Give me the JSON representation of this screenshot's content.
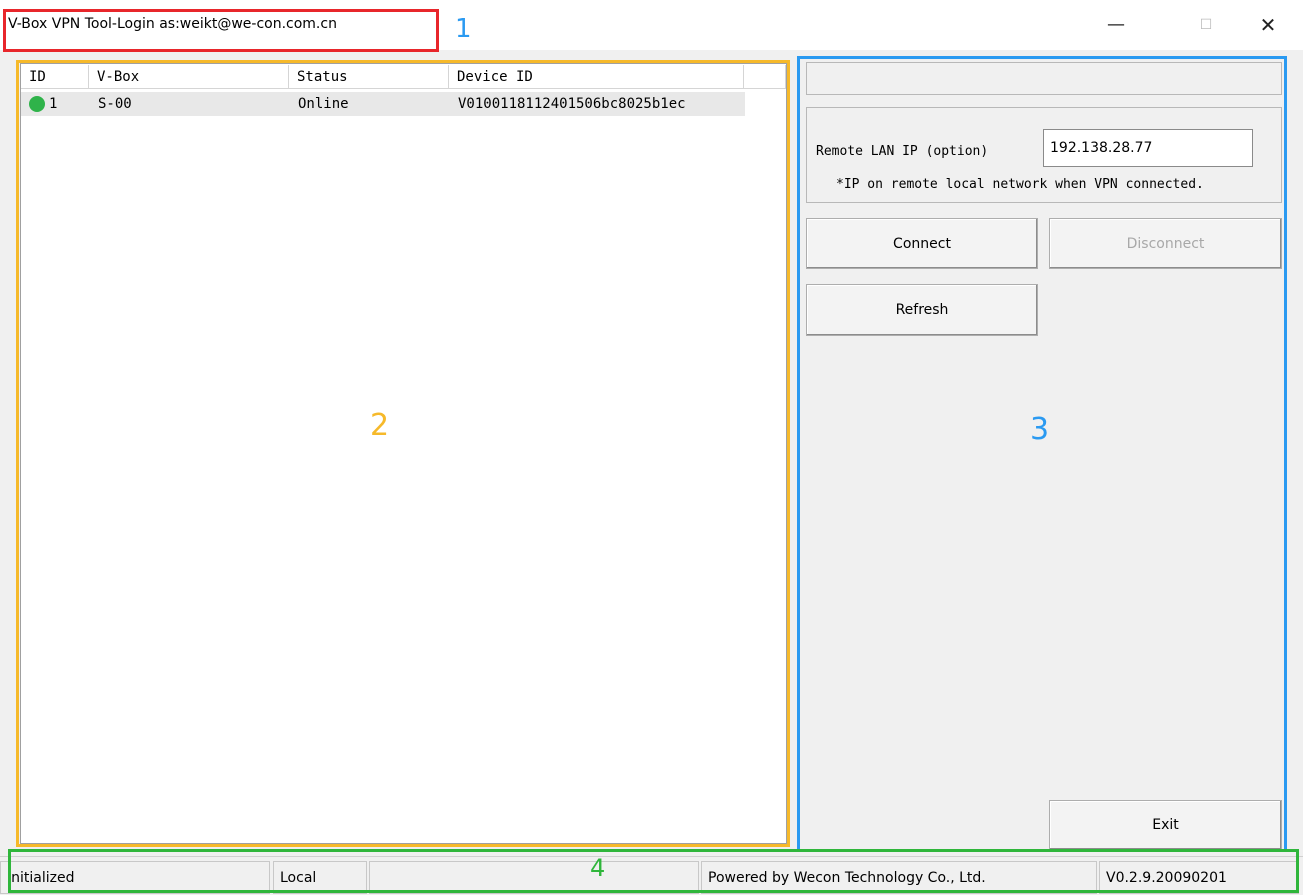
{
  "window": {
    "title": "V-Box VPN Tool-Login as:weikt@we-con.com.cn",
    "min_glyph": "—",
    "max_glyph": "☐",
    "close_glyph": "✕"
  },
  "annotations": [
    "1",
    "2",
    "3",
    "4"
  ],
  "device_list": {
    "columns": [
      "ID",
      "V-Box",
      "Status",
      "Device ID"
    ],
    "rows": [
      {
        "id": "1",
        "vbox": "S-00",
        "status": "Online",
        "device_id": "V0100118112401506bc8025b1ec",
        "status_color": "#2fb34a"
      }
    ]
  },
  "vpn_panel": {
    "remote_ip_label": "Remote LAN IP (option)",
    "remote_ip_value": "192.138.28.77",
    "remote_ip_note": "*IP on remote local network when VPN connected.",
    "connect_label": "Connect",
    "disconnect_label": "Disconnect",
    "refresh_label": "Refresh",
    "exit_label": "Exit"
  },
  "status_bar": {
    "state": "Initialized",
    "mode": "Local",
    "empty": "",
    "powered_by": "Powered by Wecon Technology Co., Ltd.",
    "version": "V0.2.9.20090201"
  },
  "colors": {
    "annotation_1": "#e8262b",
    "annotation_2": "#f6b92a",
    "annotation_3": "#2b9af1",
    "annotation_4": "#2fb63b"
  }
}
